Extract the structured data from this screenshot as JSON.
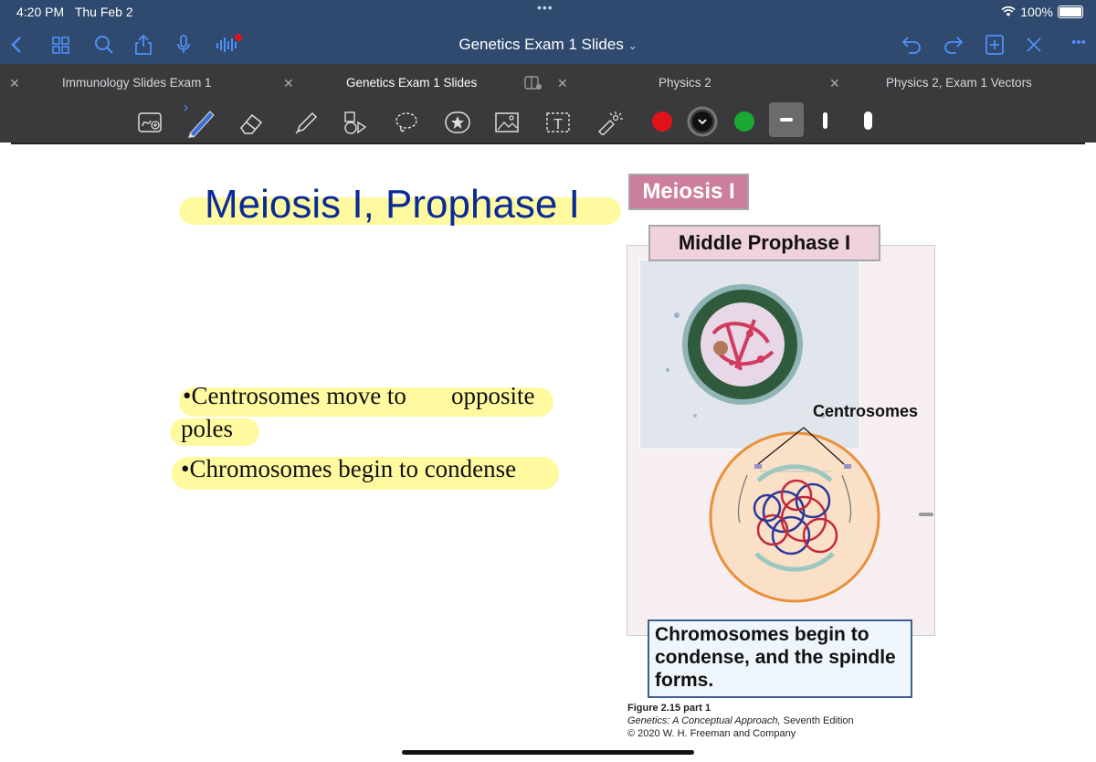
{
  "status_bar": {
    "time": "4:20 PM",
    "date": "Thu Feb 2",
    "battery": "100%",
    "multitask_dots": "•••"
  },
  "nav": {
    "title": "Genetics Exam 1 Slides",
    "more": "•••"
  },
  "tabs": [
    {
      "label": "Immunology Slides Exam 1"
    },
    {
      "label": "Genetics Exam 1 Slides"
    },
    {
      "label": "Physics 2"
    },
    {
      "label": "Physics 2, Exam 1 Vectors"
    }
  ],
  "colors": {
    "pen_red": "#e0131b",
    "pen_black": "#111111",
    "pen_green": "#1aa832",
    "highlight": "#fffaa0",
    "title_blue": "#0a2a96",
    "bar": "#2f4a6e"
  },
  "slide": {
    "title": "Meiosis I, Prophase I",
    "bullets": [
      "•Centrosomes move to",
      "opposite",
      "poles",
      "•Chromosomes begin to condense"
    ],
    "figure": {
      "header": "Meiosis I",
      "subheader": "Middle Prophase I",
      "label": "Centrosomes",
      "caption": "Chromosomes begin to condense, and the spindle forms.",
      "credit_line1": "Figure 2.15 part 1",
      "credit_book": "Genetics: A Conceptual Approach,",
      "credit_edition": " Seventh Edition",
      "credit_line3": "© 2020 W. H. Freeman and Company"
    }
  }
}
